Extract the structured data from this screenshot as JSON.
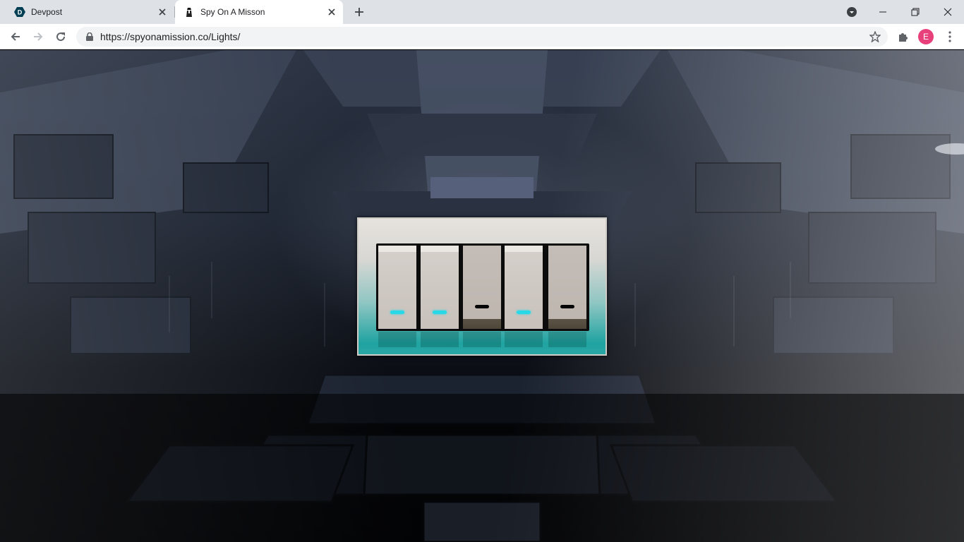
{
  "browser": {
    "tabs": [
      {
        "title": "Devpost",
        "favicon": "devpost-logo-icon",
        "active": false
      },
      {
        "title": "Spy On A Misson",
        "favicon": "spy-figure-icon",
        "active": true
      }
    ],
    "url": "https://spyonamission.co/Lights/",
    "profile_initial": "E",
    "profile_color": "#e8407a"
  },
  "lights_panel": {
    "switches": [
      {
        "state": "on",
        "indicator_color": "#29d8e6"
      },
      {
        "state": "on",
        "indicator_color": "#29d8e6"
      },
      {
        "state": "off",
        "indicator_color": "#050505"
      },
      {
        "state": "on",
        "indicator_color": "#29d8e6"
      },
      {
        "state": "off",
        "indicator_color": "#050505"
      }
    ],
    "plate_accent_color": "#1fa3a1"
  }
}
